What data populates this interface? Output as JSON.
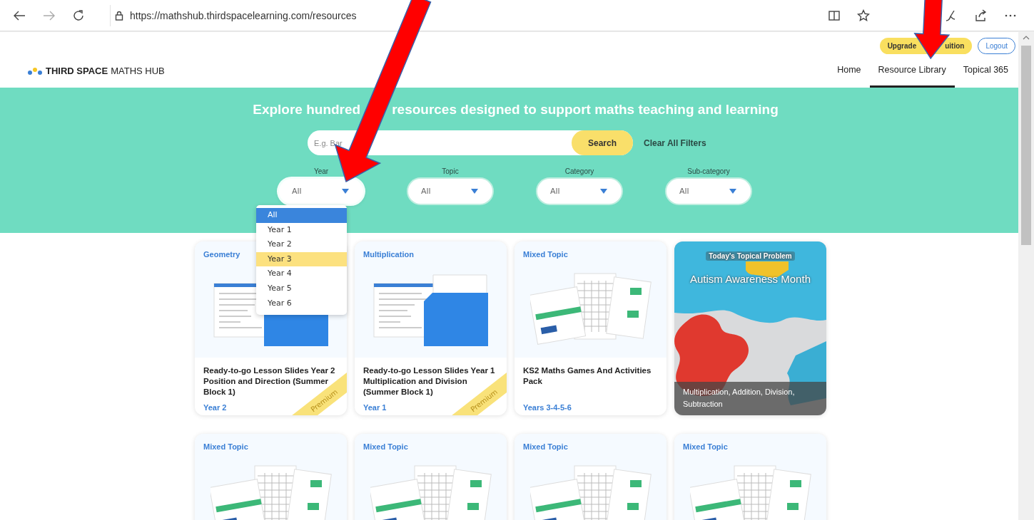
{
  "browser": {
    "url": "https://mathshub.thirdspacelearning.com/resources"
  },
  "account_bar": {
    "buttons": [
      {
        "kind": "upgrade",
        "label_parts": [
          "Upgrade",
          "uition"
        ]
      },
      {
        "kind": "logout",
        "label_parts": [
          "Logout"
        ]
      }
    ]
  },
  "header": {
    "logo": {
      "brand": "THIRD SPACE",
      "product": "MATHS HUB"
    },
    "nav": [
      {
        "label": "Home",
        "selected": false
      },
      {
        "label": "Resource Library",
        "selected": true
      },
      {
        "label": "Topical 365",
        "selected": false
      }
    ]
  },
  "hero": {
    "heading_parts": [
      "Explore hundred",
      "resources designed to support maths teaching and learning"
    ],
    "search": {
      "placeholder": "E.g. Bar",
      "button": "Search"
    },
    "clear_filters": "Clear All Filters",
    "filters": [
      {
        "label": "Year",
        "value": "All",
        "expanded": true
      },
      {
        "label": "Topic",
        "value": "All",
        "expanded": false
      },
      {
        "label": "Category",
        "value": "All",
        "expanded": false
      },
      {
        "label": "Sub-category",
        "value": "All",
        "expanded": false
      }
    ],
    "dropdown": {
      "options": [
        {
          "label": "All",
          "selected": true,
          "hovered": false
        },
        {
          "label": "Year 1",
          "selected": false,
          "hovered": false
        },
        {
          "label": "Year 2",
          "selected": false,
          "hovered": false
        },
        {
          "label": "Year 3",
          "selected": false,
          "hovered": true
        },
        {
          "label": "Year 4",
          "selected": false,
          "hovered": false
        },
        {
          "label": "Year 5",
          "selected": false,
          "hovered": false
        },
        {
          "label": "Year 6",
          "selected": false,
          "hovered": false
        }
      ]
    }
  },
  "cards": [
    {
      "kind": "lesson_slides",
      "topic": "Geometry",
      "title": "Ready-to-go Lesson Slides Year 2 Position and Direction (Summer Block 1)",
      "years": "Year 2",
      "badge": "Premium"
    },
    {
      "kind": "lesson_slides",
      "topic": "Multiplication",
      "title": "Ready-to-go Lesson Slides Year 1 Multiplication and Division (Summer Block 1)",
      "years": "Year 1",
      "badge": "Premium"
    },
    {
      "kind": "activity_pack",
      "topic": "Mixed Topic",
      "title": "KS2 Maths Games And Activities Pack",
      "years": "Years 3-4-5-6"
    },
    {
      "kind": "topical",
      "eyebrow": "Today's Topical Problem",
      "title": "Autism Awareness Month",
      "topics": "Multiplication, Addition, Division, Subtraction"
    },
    {
      "kind": "activity_pack",
      "topic": "Mixed Topic"
    },
    {
      "kind": "activity_pack",
      "topic": "Mixed Topic"
    },
    {
      "kind": "activity_pack",
      "topic": "Mixed Topic"
    },
    {
      "kind": "activity_pack",
      "topic": "Mixed Topic"
    }
  ]
}
